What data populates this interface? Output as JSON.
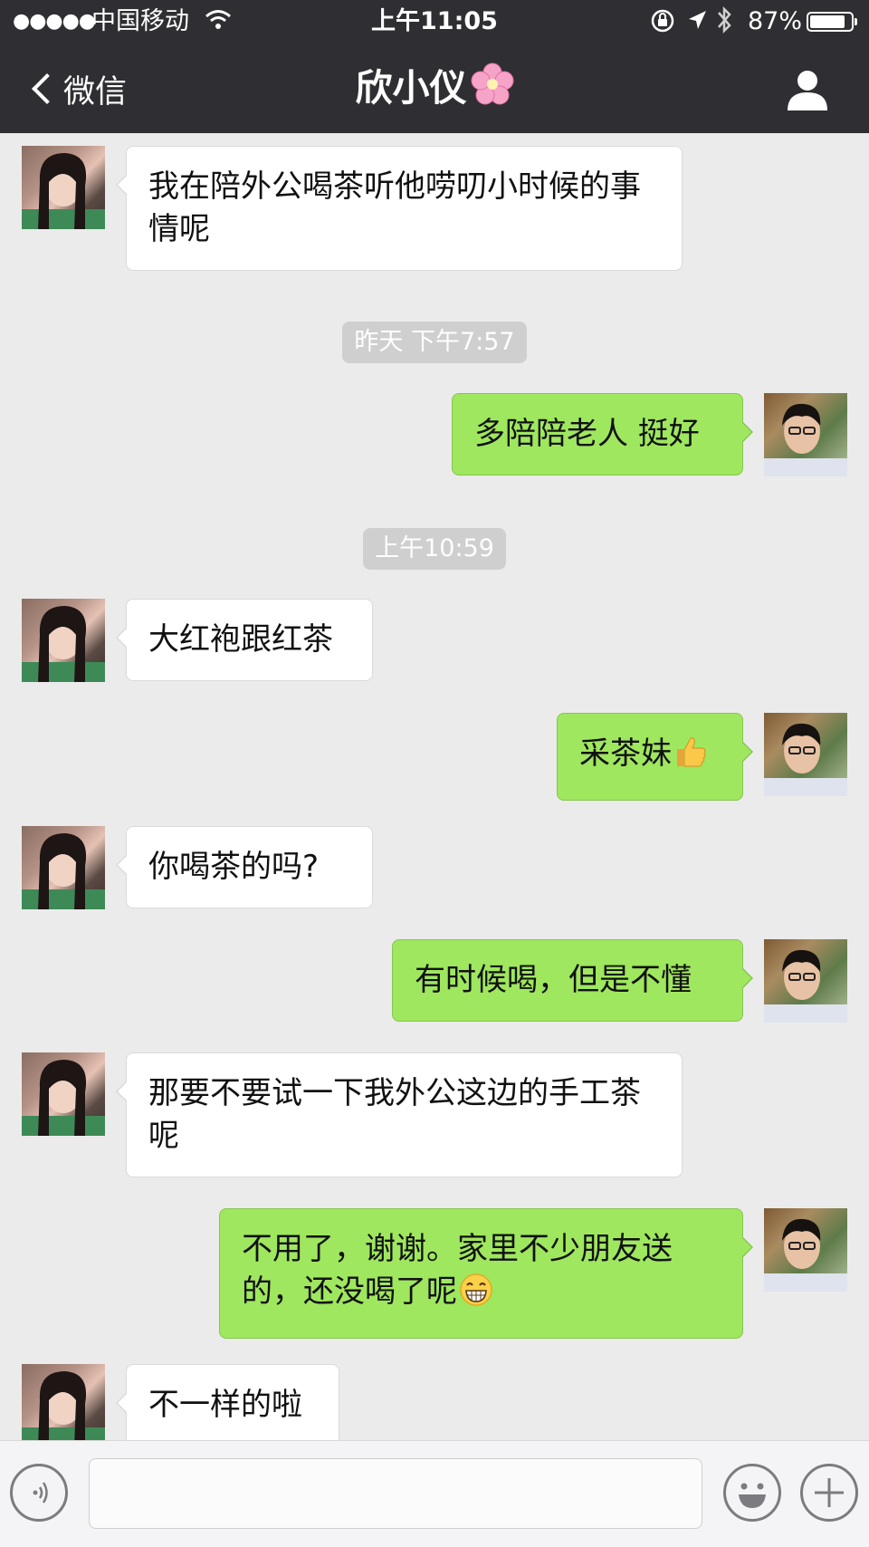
{
  "status_bar": {
    "signal": "●●●●●",
    "carrier": "中国移动",
    "time": "上午11:05",
    "battery_percent": "87%",
    "battery_level": 0.87
  },
  "nav": {
    "back_label": "微信",
    "title": "欣小仪"
  },
  "messages": [
    {
      "from": "contact",
      "text": "我在陪外公喝茶听他唠叨小时候的事情呢"
    },
    {
      "timestamp": "昨天 下午7:57"
    },
    {
      "from": "me",
      "text": "多陪陪老人 挺好"
    },
    {
      "timestamp": "上午10:59"
    },
    {
      "from": "contact",
      "text": "大红袍跟红茶"
    },
    {
      "from": "me",
      "text": "采茶妹",
      "emoji": "thumbs-up"
    },
    {
      "from": "contact",
      "text": "你喝茶的吗?"
    },
    {
      "from": "me",
      "text": "有时候喝，但是不懂"
    },
    {
      "from": "contact",
      "text": "那要不要试一下我外公这边的手工茶呢"
    },
    {
      "from": "me",
      "text": "不用了，谢谢。家里不少朋友送的，还没喝了呢",
      "emoji": "grin"
    },
    {
      "from": "contact",
      "text": "不一样的啦"
    }
  ],
  "input": {
    "value": "",
    "placeholder": ""
  },
  "colors": {
    "header_bg": "#2f2f33",
    "chat_bg": "#ebebeb",
    "outgoing_bubble": "#9fe75e",
    "incoming_bubble": "#ffffff",
    "timestamp_bg": "#cfcfcf"
  }
}
